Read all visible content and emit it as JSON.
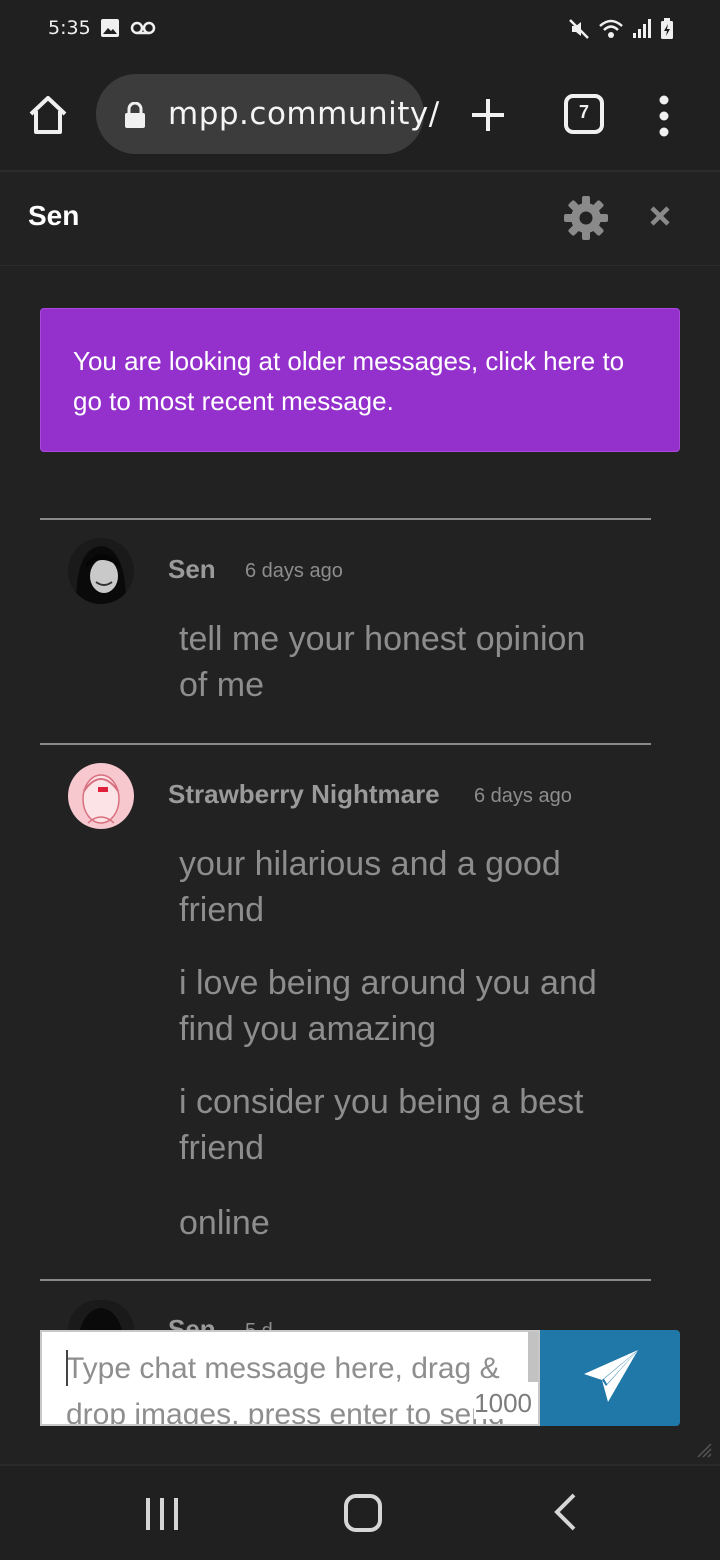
{
  "status_bar": {
    "time": "5:35",
    "left_icons": [
      "image-icon",
      "voicemail-icon"
    ],
    "right_icons": [
      "mute-icon",
      "wifi-icon",
      "signal-icon",
      "battery-charging-icon"
    ]
  },
  "browser": {
    "url": "mpp.community/",
    "tab_count": "7",
    "icons": [
      "home-icon",
      "lock-icon",
      "plus-icon",
      "tabs-icon",
      "more-vert-icon"
    ]
  },
  "chat": {
    "title": "Sen",
    "older_banner": "You are looking at older messages, click here to go to most recent message.",
    "messages": [
      {
        "user": "Sen",
        "time": "6 days ago",
        "lines": [
          "tell me your honest opinion of me"
        ]
      },
      {
        "user": "Strawberry Nightmare",
        "time": "6 days ago",
        "lines": [
          "your hilarious and a good friend",
          "i love being around you and find you amazing",
          "i consider you being a best friend",
          "online"
        ]
      },
      {
        "user": "Sen",
        "time": "5 d",
        "lines": []
      }
    ],
    "composer": {
      "placeholder": "Type chat message here, drag & drop images, press enter to send",
      "char_limit": "1000"
    }
  },
  "colors": {
    "background": "#202020",
    "banner": "#9430cc",
    "send_button": "#1f78a8",
    "message_text": "#8d8d8d"
  }
}
